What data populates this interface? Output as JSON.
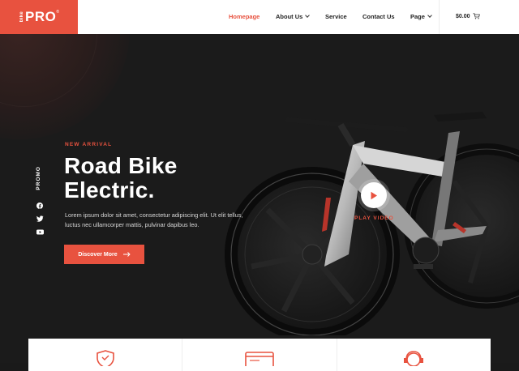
{
  "brand": {
    "small": "bike",
    "main": "PRO",
    "reg": "®",
    "accent": "#e8523f"
  },
  "nav": {
    "items": [
      {
        "label": "Homepage",
        "active": true
      },
      {
        "label": "About Us",
        "dropdown": true
      },
      {
        "label": "Service"
      },
      {
        "label": "Contact Us"
      },
      {
        "label": "Page",
        "dropdown": true
      }
    ],
    "cart": "$0.00"
  },
  "hero": {
    "promo": "PROMO",
    "social": [
      "facebook-icon",
      "twitter-icon",
      "youtube-icon"
    ],
    "eyebrow": "NEW ARRIVAL",
    "title_line1": "Road Bike",
    "title_line2": "Electric.",
    "description": "Lorem ipsum dolor sit amet, consectetur adipiscing elit. Ut elit tellus, luctus nec ullamcorper mattis, pulvinar dapibus leo.",
    "button": "Discover More",
    "play_label": "PLAY VIDEO"
  },
  "features": {
    "icons": [
      "shield-icon",
      "card-icon",
      "support-icon"
    ]
  }
}
